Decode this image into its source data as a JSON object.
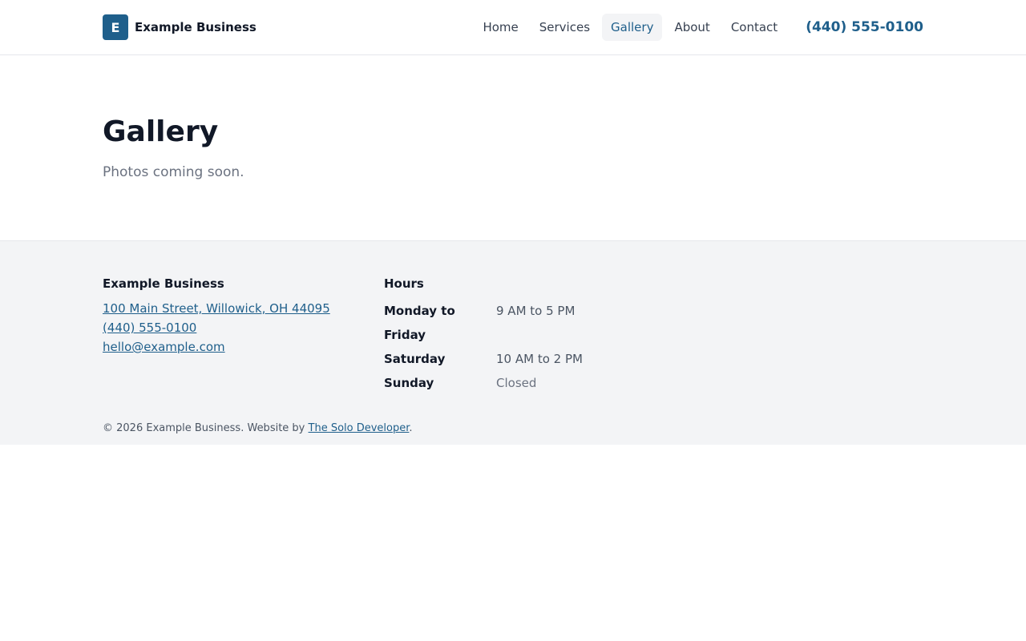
{
  "header": {
    "logo_letter": "E",
    "brand_name": "Example Business",
    "nav": [
      {
        "label": "Home"
      },
      {
        "label": "Services"
      },
      {
        "label": "Gallery"
      },
      {
        "label": "About"
      },
      {
        "label": "Contact"
      }
    ],
    "phone": "(440) 555-0100"
  },
  "main": {
    "title": "Gallery",
    "lead": "Photos coming soon."
  },
  "footer": {
    "contact_heading": "Example Business",
    "address": "100 Main Street, Willowick, OH 44095",
    "phone": "(440) 555-0100",
    "email": "hello@example.com",
    "hours_heading": "Hours",
    "hours": [
      {
        "day": "Monday to Friday",
        "time": "9 AM to 5 PM"
      },
      {
        "day": "Saturday",
        "time": "10 AM to 2 PM"
      },
      {
        "day": "Sunday",
        "time": "Closed"
      }
    ],
    "copyright_prefix": "© 2026 Example Business. Website by ",
    "developer_link": "The Solo Developer",
    "copyright_suffix": "."
  },
  "colors": {
    "accent": "#1f5f8b",
    "footer_bg": "#f3f4f6"
  }
}
